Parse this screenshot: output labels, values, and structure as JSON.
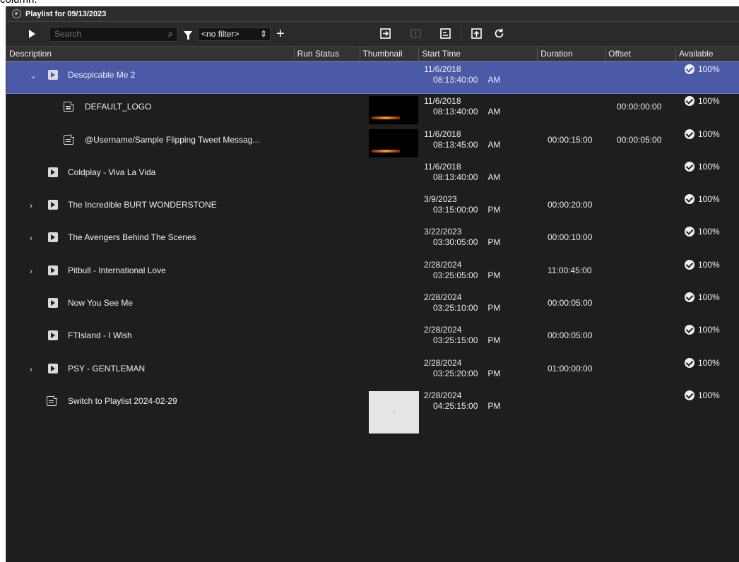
{
  "top_text": "column.",
  "window": {
    "title": "Playlist for 09/13/2023"
  },
  "toolbar": {
    "search_placeholder": "Search",
    "filter_value": "<no filter>",
    "add_label": "+"
  },
  "columns": [
    "Description",
    "Run Status",
    "Thumbnail",
    "Start Time",
    "Duration",
    "Offset",
    "Available"
  ],
  "rows": [
    {
      "label": "Descpicable Me 2",
      "date": "11/6/2018",
      "time": "08:13:40:00",
      "ampm": "AM",
      "duration": "",
      "offset": "",
      "available": "100%"
    },
    {
      "label": "DEFAULT_LOGO",
      "date": "11/6/2018",
      "time": "08:13:40:00",
      "ampm": "AM",
      "duration": "",
      "offset": "00:00:00:00",
      "available": "100%"
    },
    {
      "label": "@Username/Sample Flipping Tweet Messag...",
      "date": "11/6/2018",
      "time": "08:13:45:00",
      "ampm": "AM",
      "duration": "00:00:15:00",
      "offset": "00:00:05:00",
      "available": "100%"
    },
    {
      "label": "Coldplay - Viva La Vida",
      "date": "11/6/2018",
      "time": "08:13:40:00",
      "ampm": "AM",
      "duration": "",
      "offset": "",
      "available": "100%"
    },
    {
      "label": "The Incredible BURT WONDERSTONE",
      "date": "3/9/2023",
      "time": "03:15:00:00",
      "ampm": "PM",
      "duration": "00:00:20:00",
      "offset": "",
      "available": "100%"
    },
    {
      "label": "The Avengers Behind The Scenes",
      "date": "3/22/2023",
      "time": "03:30:05:00",
      "ampm": "PM",
      "duration": "00:00:10:00",
      "offset": "",
      "available": "100%"
    },
    {
      "label": "Pitbull - International Love",
      "date": "2/28/2024",
      "time": "03:25:05:00",
      "ampm": "PM",
      "duration": "11:00:45:00",
      "offset": "",
      "available": "100%"
    },
    {
      "label": "Now You See Me",
      "date": "2/28/2024",
      "time": "03:25:10:00",
      "ampm": "PM",
      "duration": "00:00:05:00",
      "offset": "",
      "available": "100%"
    },
    {
      "label": "FTIsland - I Wish",
      "date": "2/28/2024",
      "time": "03:25:15:00",
      "ampm": "PM",
      "duration": "00:00:05:00",
      "offset": "",
      "available": "100%"
    },
    {
      "label": "PSY - GENTLEMAN",
      "date": "2/28/2024",
      "time": "03:25:20:00",
      "ampm": "PM",
      "duration": "01:00:00:00",
      "offset": "",
      "available": "100%"
    },
    {
      "label": "Switch to Playlist 2024-02-29",
      "date": "2/28/2024",
      "time": "04:25:15:00",
      "ampm": "PM",
      "duration": "",
      "offset": "",
      "available": "100%"
    }
  ],
  "colors": {
    "selected_row": "#4a5aa6",
    "background": "#1e1e1e",
    "header": "#333333"
  }
}
